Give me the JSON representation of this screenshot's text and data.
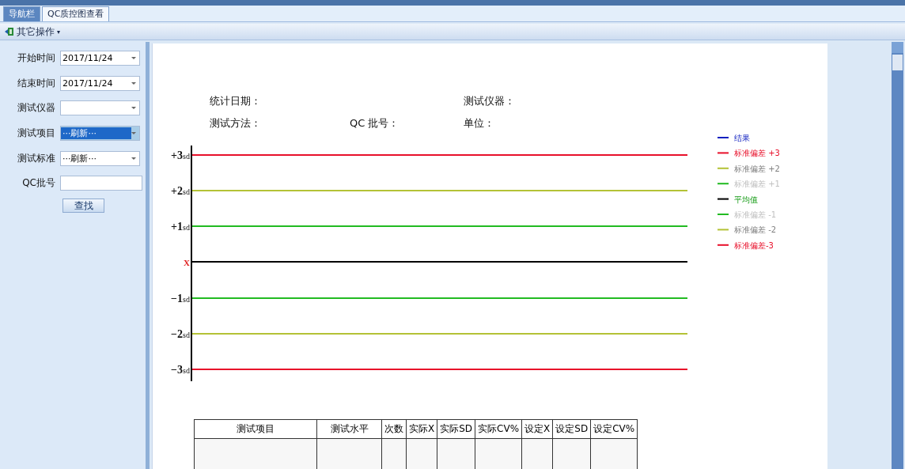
{
  "tabs": [
    {
      "label": "导航栏",
      "selected": false
    },
    {
      "label": "QC质控图查看",
      "selected": true
    }
  ],
  "toolbar": {
    "menu": "其它操作",
    "caret": "▾"
  },
  "filters": [
    {
      "label": "开始时间",
      "kind": "combo",
      "value": "2017/11/24",
      "focused": false
    },
    {
      "label": "结束时间",
      "kind": "combo",
      "value": "2017/11/24",
      "focused": false
    },
    {
      "label": "测试仪器",
      "kind": "combo",
      "focused": false
    },
    {
      "label": "测试项目",
      "kind": "combo",
      "value": "···刷新···",
      "focused": true
    },
    {
      "label": "测试标准",
      "kind": "combo",
      "value": "···刷新···",
      "focused": false
    },
    {
      "label": "QC批号",
      "kind": "text",
      "focused": false
    }
  ],
  "search_button": "查找",
  "report": {
    "info": [
      {
        "label": "统计日期："
      },
      {
        "label": "测试仪器："
      },
      {
        "label": "测试方法："
      },
      {
        "label": "QC 批号："
      },
      {
        "label": "单位："
      }
    ],
    "lines": [
      {
        "kind": "sd",
        "label": "+3",
        "unit": "sd",
        "color": "#e8102a"
      },
      {
        "kind": "sd",
        "label": "+2",
        "unit": "sd",
        "color": "#b4c236"
      },
      {
        "kind": "sd",
        "label": "+1",
        "unit": "sd",
        "color": "#22bb22"
      },
      {
        "kind": "mean",
        "label": "X",
        "color": "#000000"
      },
      {
        "kind": "sd",
        "label": "−1",
        "unit": "sd",
        "color": "#22bb22"
      },
      {
        "kind": "sd",
        "label": "−2",
        "unit": "sd",
        "color": "#b4c236"
      },
      {
        "kind": "sd",
        "label": "−3",
        "unit": "sd",
        "color": "#e8102a"
      }
    ],
    "legend": [
      {
        "label": "结果",
        "color": "#1020c0",
        "kind": "strong"
      },
      {
        "label": "标准偏差 +3",
        "color": "#e8102a",
        "kind": "strong"
      },
      {
        "label": "标准偏差 +2",
        "color": "#b4c236",
        "kind": "muted"
      },
      {
        "label": "标准偏差 +1",
        "color": "#22bb22",
        "kind": "faint"
      },
      {
        "label": "平均值",
        "color": "#000000",
        "kind": "highlight"
      },
      {
        "label": "标准偏差 -1",
        "color": "#22bb22",
        "kind": "faint"
      },
      {
        "label": "标准偏差 -2",
        "color": "#b4c236",
        "kind": "muted"
      },
      {
        "label": "标准偏差-3",
        "color": "#e8102a",
        "kind": "strong"
      }
    ],
    "table": {
      "columns": [
        "测试项目",
        "测试水平",
        "次数",
        "实际X",
        "实际SD",
        "实际CV%",
        "设定X",
        "设定SD",
        "设定CV%"
      ]
    }
  }
}
